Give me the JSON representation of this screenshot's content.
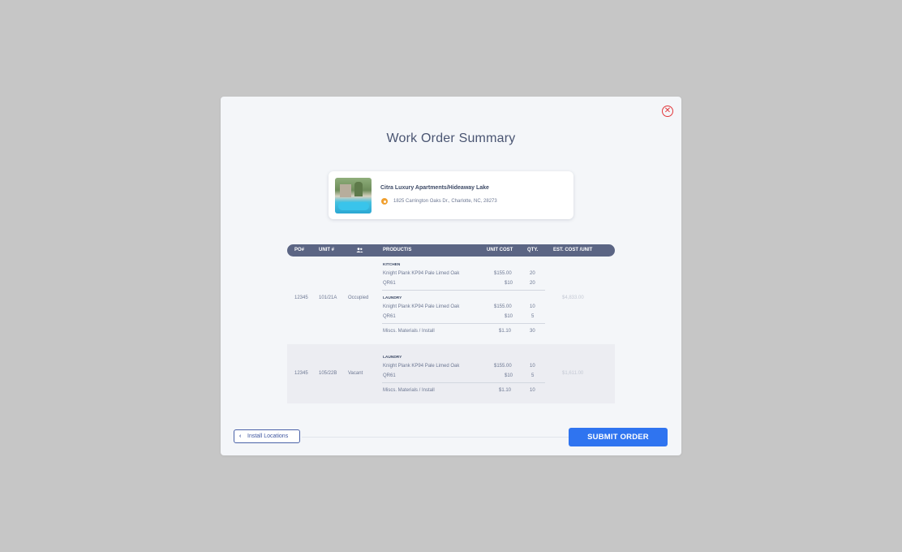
{
  "modal": {
    "title": "Work Order Summary",
    "close_icon": "close-circle-icon",
    "accent_color": "#2f74f0",
    "close_color": "#e2363a"
  },
  "property": {
    "name": "Citra Luxury Apartments/Hideaway Lake",
    "address": "1825 Carrington Oaks Dr., Charlotte, NC, 28273",
    "location_icon": "location-pin-icon"
  },
  "table": {
    "headers": {
      "po": "PO#",
      "unit": "UNIT #",
      "occupancy_icon": "users-icon",
      "products": "PRODUCT/S",
      "unit_cost": "UNIT COST",
      "qty": "QTY.",
      "est_cost": "EST. COST /UNIT"
    },
    "rows": [
      {
        "po": "12345",
        "unit": "101/21A",
        "status": "Occupied",
        "est_cost": "$4,833.00",
        "sections": [
          {
            "label": "KITCHEN",
            "items": [
              {
                "product": "Knight Plank KP94 Pale Limed Oak",
                "cost": "$155.00",
                "qty": "20"
              },
              {
                "product": "QR61",
                "cost": "$10",
                "qty": "20"
              }
            ]
          },
          {
            "label": "LAUNDRY",
            "items": [
              {
                "product": "Knight Plank KP94 Pale Limed Oak",
                "cost": "$155.00",
                "qty": "10"
              },
              {
                "product": "QR61",
                "cost": "$10",
                "qty": "5"
              }
            ]
          }
        ],
        "misc": {
          "product": "Miscs. Materials / Install",
          "cost": "$1.10",
          "qty": "30"
        }
      },
      {
        "po": "12345",
        "unit": "105/22B",
        "status": "Vacant",
        "est_cost": "$1,611.00",
        "sections": [
          {
            "label": "LAUNDRY",
            "items": [
              {
                "product": "Knight Plank KP94 Pale Limed Oak",
                "cost": "$155.00",
                "qty": "10"
              },
              {
                "product": "QR61",
                "cost": "$10",
                "qty": "5"
              }
            ]
          }
        ],
        "misc": {
          "product": "Miscs. Materials / Install",
          "cost": "$1.10",
          "qty": "10"
        }
      }
    ]
  },
  "footer": {
    "back_label": "Install Locations",
    "back_icon": "chevron-left-icon",
    "submit_label": "SUBMIT ORDER"
  }
}
